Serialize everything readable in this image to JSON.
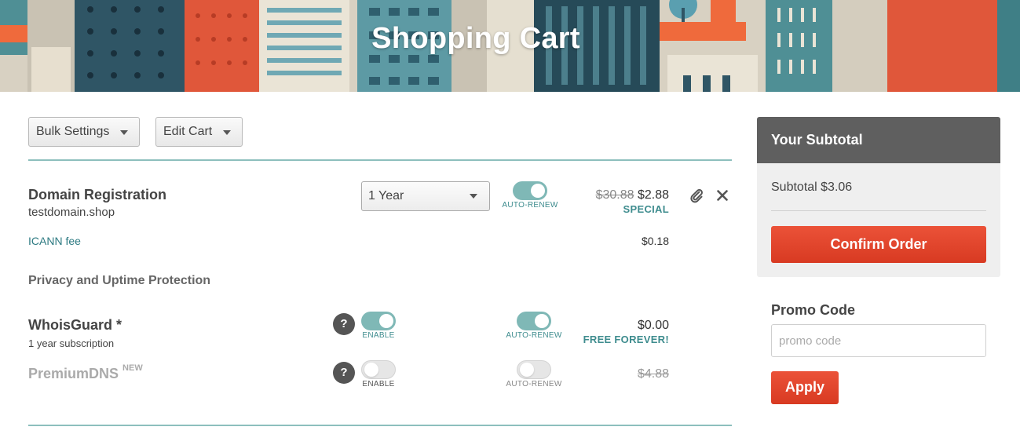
{
  "banner": {
    "title": "Shopping Cart"
  },
  "toolbar": {
    "bulk_settings_label": "Bulk Settings",
    "edit_cart_label": "Edit Cart"
  },
  "domain_item": {
    "title": "Domain Registration",
    "domain": "testdomain.shop",
    "period_selected": "1 Year",
    "auto_renew": {
      "label": "AUTO-RENEW",
      "on": true
    },
    "old_price": "$30.88",
    "price": "$2.88",
    "badge": "SPECIAL",
    "attach_icon": "paperclip-icon",
    "remove_icon": "close-icon",
    "fee_label": "ICANN fee",
    "fee_price": "$0.18"
  },
  "privacy_section": {
    "heading": "Privacy and Uptime Protection"
  },
  "whoisguard": {
    "title": "WhoisGuard *",
    "subtitle": "1 year subscription",
    "help_glyph": "?",
    "enable": {
      "label": "ENABLE",
      "on": true
    },
    "auto_renew": {
      "label": "AUTO-RENEW",
      "on": true
    },
    "price": "$0.00",
    "badge": "FREE FOREVER!"
  },
  "premiumdns": {
    "title": "PremiumDNS",
    "new_tag": "NEW",
    "help_glyph": "?",
    "enable": {
      "label": "ENABLE",
      "on": false
    },
    "auto_renew": {
      "label": "AUTO-RENEW",
      "on": false
    },
    "price": "$4.88"
  },
  "sidebar": {
    "subtotal_heading": "Your Subtotal",
    "subtotal_line": "Subtotal $3.06",
    "confirm_label": "Confirm Order",
    "promo_heading": "Promo Code",
    "promo_placeholder": "promo code",
    "promo_value": "",
    "apply_label": "Apply"
  },
  "colors": {
    "accent_teal": "#3e8c8e",
    "toggle_on": "#7fb8b6",
    "primary_red": "#e24a30",
    "subtotal_header": "#5f5f5f"
  }
}
